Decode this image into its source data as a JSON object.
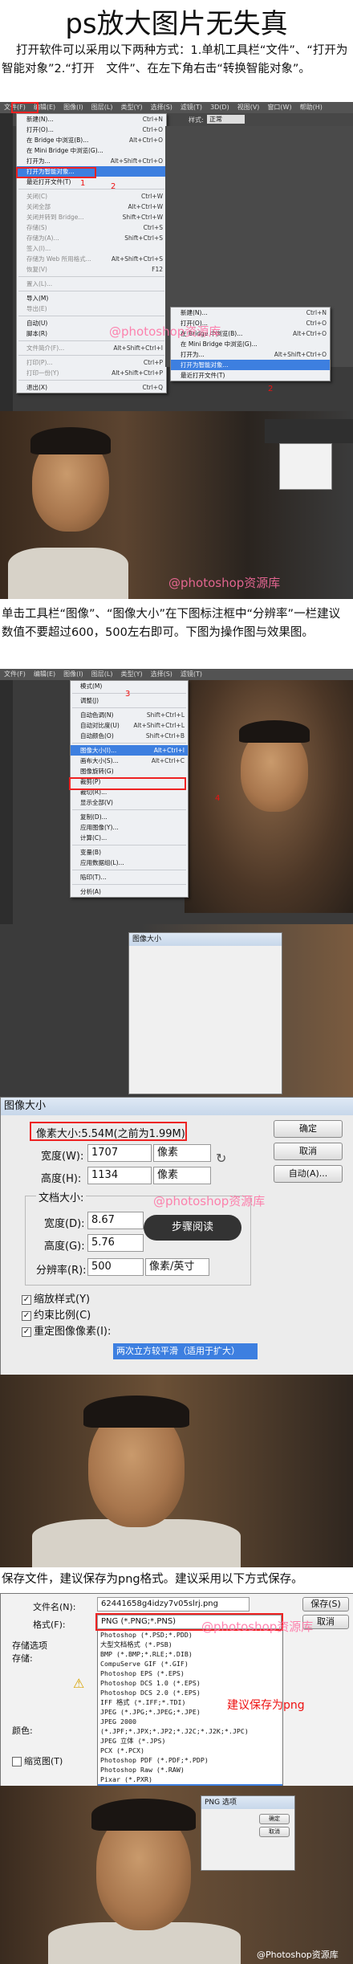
{
  "title": "ps放大图片无失真",
  "intro": "打开软件可以采用以下两种方式：1.单机工具栏“文件”、“打开为智能对象”2.“打开　文件”、在左下角右击“转换智能对象”。",
  "step2": "单击工具栏“图像”、“图像大小”在下图标注框中“分辨率”一栏建议数值不要超过600，500左右即可。下图为操作图与效果图。",
  "step3": "保存文件，建议保存为png格式。建议采用以下方式保存。",
  "watermark": "@photoshop资源库",
  "footer_watermark": "@Photoshop资源库",
  "ps_menubar": [
    "文件(F)",
    "编辑(E)",
    "图像(I)",
    "图层(L)",
    "类型(Y)",
    "选择(S)",
    "滤镜(T)",
    "3D(D)",
    "视图(V)",
    "窗口(W)",
    "帮助(H)"
  ],
  "file_menu": [
    {
      "label": "新建(N)...",
      "sc": "Ctrl+N",
      "state": ""
    },
    {
      "label": "打开(O)...",
      "sc": "Ctrl+O",
      "state": ""
    },
    {
      "label": "在 Bridge 中浏览(B)...",
      "sc": "Alt+Ctrl+O",
      "state": ""
    },
    {
      "label": "在 Mini Bridge 中浏览(G)...",
      "sc": "",
      "state": ""
    },
    {
      "label": "打开为...",
      "sc": "Alt+Shift+Ctrl+O",
      "state": ""
    },
    {
      "label": "打开为智能对象...",
      "sc": "",
      "state": "hl"
    },
    {
      "label": "最近打开文件(T)",
      "sc": "",
      "state": ""
    },
    {
      "label": "-",
      "sc": "",
      "state": ""
    },
    {
      "label": "关闭(C)",
      "sc": "Ctrl+W",
      "state": "dis"
    },
    {
      "label": "关闭全部",
      "sc": "Alt+Ctrl+W",
      "state": "dis"
    },
    {
      "label": "关闭并转到 Bridge...",
      "sc": "Shift+Ctrl+W",
      "state": "dis"
    },
    {
      "label": "存储(S)",
      "sc": "Ctrl+S",
      "state": "dis"
    },
    {
      "label": "存储为(A)...",
      "sc": "Shift+Ctrl+S",
      "state": "dis"
    },
    {
      "label": "签入(I)...",
      "sc": "",
      "state": "dis"
    },
    {
      "label": "存储为 Web 所用格式...",
      "sc": "Alt+Shift+Ctrl+S",
      "state": "dis"
    },
    {
      "label": "恢复(V)",
      "sc": "F12",
      "state": "dis"
    },
    {
      "label": "-",
      "sc": "",
      "state": ""
    },
    {
      "label": "置入(L)...",
      "sc": "",
      "state": "dis"
    },
    {
      "label": "-",
      "sc": "",
      "state": ""
    },
    {
      "label": "导入(M)",
      "sc": "",
      "state": ""
    },
    {
      "label": "导出(E)",
      "sc": "",
      "state": "dis"
    },
    {
      "label": "-",
      "sc": "",
      "state": ""
    },
    {
      "label": "自动(U)",
      "sc": "",
      "state": ""
    },
    {
      "label": "脚本(R)",
      "sc": "",
      "state": ""
    },
    {
      "label": "-",
      "sc": "",
      "state": ""
    },
    {
      "label": "文件简介(F)...",
      "sc": "Alt+Shift+Ctrl+I",
      "state": "dis"
    },
    {
      "label": "-",
      "sc": "",
      "state": ""
    },
    {
      "label": "打印(P)...",
      "sc": "Ctrl+P",
      "state": "dis"
    },
    {
      "label": "打印一份(Y)",
      "sc": "Alt+Shift+Ctrl+P",
      "state": "dis"
    },
    {
      "label": "-",
      "sc": "",
      "state": ""
    },
    {
      "label": "退出(X)",
      "sc": "Ctrl+Q",
      "state": ""
    }
  ],
  "mini_menu": [
    {
      "label": "新建(N)...",
      "sc": "Ctrl+N",
      "state": ""
    },
    {
      "label": "打开(O)...",
      "sc": "Ctrl+O",
      "state": ""
    },
    {
      "label": "在 Bridge 中浏览(B)...",
      "sc": "Alt+Ctrl+O",
      "state": ""
    },
    {
      "label": "在 Mini Bridge 中浏览(G)...",
      "sc": "",
      "state": ""
    },
    {
      "label": "打开为...",
      "sc": "Alt+Shift+Ctrl+O",
      "state": ""
    },
    {
      "label": "打开为智能对象...",
      "sc": "",
      "state": "hl"
    },
    {
      "label": "最近打开文件(T)",
      "sc": "",
      "state": ""
    }
  ],
  "marker1": "1",
  "marker2": "2",
  "options_bar": {
    "style_label": "样式:",
    "style_value": "正常"
  },
  "ps2_menubar": [
    "文件(F)",
    "编辑(E)",
    "图像(I)",
    "图层(L)",
    "类型(Y)",
    "选择(S)",
    "滤镜(T)"
  ],
  "image_menu": [
    {
      "label": "模式(M)",
      "sc": "",
      "state": ""
    },
    {
      "label": "-",
      "sc": "",
      "state": ""
    },
    {
      "label": "调整(J)",
      "sc": "",
      "state": ""
    },
    {
      "label": "-",
      "sc": "",
      "state": ""
    },
    {
      "label": "自动色调(N)",
      "sc": "Shift+Ctrl+L",
      "state": ""
    },
    {
      "label": "自动对比度(U)",
      "sc": "Alt+Shift+Ctrl+L",
      "state": ""
    },
    {
      "label": "自动颜色(O)",
      "sc": "Shift+Ctrl+B",
      "state": ""
    },
    {
      "label": "-",
      "sc": "",
      "state": ""
    },
    {
      "label": "图像大小(I)...",
      "sc": "Alt+Ctrl+I",
      "state": "hl"
    },
    {
      "label": "画布大小(S)...",
      "sc": "Alt+Ctrl+C",
      "state": ""
    },
    {
      "label": "图像旋转(G)",
      "sc": "",
      "state": ""
    },
    {
      "label": "裁剪(P)",
      "sc": "",
      "state": ""
    },
    {
      "label": "裁切(R)...",
      "sc": "",
      "state": ""
    },
    {
      "label": "显示全部(V)",
      "sc": "",
      "state": ""
    },
    {
      "label": "-",
      "sc": "",
      "state": ""
    },
    {
      "label": "复制(D)...",
      "sc": "",
      "state": ""
    },
    {
      "label": "应用图像(Y)...",
      "sc": "",
      "state": ""
    },
    {
      "label": "计算(C)...",
      "sc": "",
      "state": ""
    },
    {
      "label": "-",
      "sc": "",
      "state": ""
    },
    {
      "label": "变量(B)",
      "sc": "",
      "state": ""
    },
    {
      "label": "应用数据组(L)...",
      "sc": "",
      "state": ""
    },
    {
      "label": "-",
      "sc": "",
      "state": ""
    },
    {
      "label": "陷印(T)...",
      "sc": "",
      "state": ""
    },
    {
      "label": "-",
      "sc": "",
      "state": ""
    },
    {
      "label": "分析(A)",
      "sc": "",
      "state": ""
    }
  ],
  "image_size": {
    "title": "图像大小",
    "pixel_header": "像素大小:5.54M(之前为1.99M)",
    "width_label": "宽度(W):",
    "width_value": "1707",
    "height_label": "高度(H):",
    "height_value": "1134",
    "pixel_unit": "像素",
    "doc_header": "文档大小:",
    "doc_width_label": "宽度(D):",
    "doc_width_value": "8.67",
    "doc_height_label": "高度(G):",
    "doc_height_value": "5.76",
    "res_label": "分辨率(R):",
    "res_value": "500",
    "res_unit": "像素/英寸",
    "ok": "确定",
    "cancel": "取消",
    "auto": "自动(A)...",
    "scale_styles": "缩放样式(Y)",
    "constrain": "约束比例(C)",
    "resample": "重定图像像素(I):",
    "resample_value": "两次立方较平滑（适用于扩大）",
    "step_badge": "步骤阅读"
  },
  "save_dialog": {
    "filename_label": "文件名(N):",
    "filename_value": "62441658g4idzy7v05slrj.png",
    "format_label": "格式(F):",
    "format_value": "PNG (*.PNG;*.PNS)",
    "save": "保存(S)",
    "cancel": "取消",
    "save_options": "存储选项",
    "store": "存储:",
    "color": "颜色:",
    "thumbnail": "缩览图(T)",
    "note": "建议保存为png",
    "formats": [
      "Photoshop (*.PSD;*.PDD)",
      "大型文档格式 (*.PSB)",
      "BMP (*.BMP;*.RLE;*.DIB)",
      "CompuServe GIF (*.GIF)",
      "Photoshop EPS (*.EPS)",
      "Photoshop DCS 1.0 (*.EPS)",
      "Photoshop DCS 2.0 (*.EPS)",
      "IFF 格式 (*.IFF;*.TDI)",
      "JPEG (*.JPG;*.JPEG;*.JPE)",
      "JPEG 2000 (*.JPF;*.JPX;*.JP2;*.J2C;*.J2K;*.JPC)",
      "JPEG 立体 (*.JPS)",
      "PCX (*.PCX)",
      "Photoshop PDF (*.PDF;*.PDP)",
      "Photoshop Raw (*.RAW)",
      "Pixar (*.PXR)",
      "PNG (*.PNG;*.PNS)"
    ]
  },
  "png_dialog": {
    "title": "PNG 选项",
    "ok": "确定",
    "cancel": "取消"
  }
}
